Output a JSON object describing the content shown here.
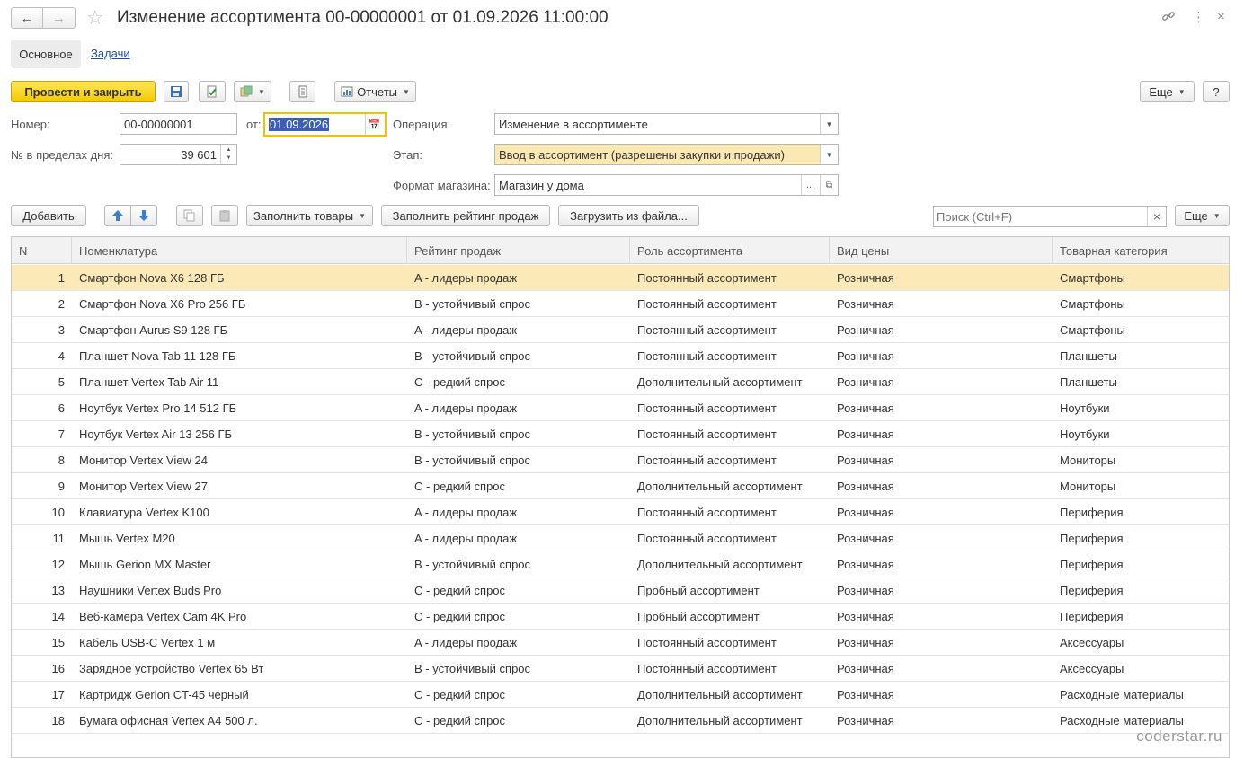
{
  "window": {
    "title": "Изменение ассортимента 00-00000001 от 01.09.2026 11:00:00"
  },
  "tabs": {
    "main": "Основное",
    "tasks": "Задачи"
  },
  "toolbar": {
    "post_close": "Провести и закрыть",
    "reports": "Отчеты",
    "more": "Еще",
    "help": "?"
  },
  "form": {
    "number_label": "Номер:",
    "number_value": "00-00000001",
    "date_label": "от:",
    "date_value": "01.09.2026",
    "daynum_label": "№ в пределах дня:",
    "daynum_value": "39 601",
    "operation_label": "Операция:",
    "operation_value": "Изменение в ассортименте",
    "stage_label": "Этап:",
    "stage_value": "Ввод в ассортимент (разрешены закупки и продажи)",
    "format_label": "Формат магазина:",
    "format_value": "Магазин у дома"
  },
  "table_toolbar": {
    "add": "Добавить",
    "fill_goods": "Заполнить товары",
    "fill_rating": "Заполнить рейтинг продаж",
    "load_file": "Загрузить из файла...",
    "search_placeholder": "Поиск (Ctrl+F)",
    "search_clear": "×",
    "more": "Еще"
  },
  "table": {
    "columns": [
      "N",
      "Номенклатура",
      "Рейтинг продаж",
      "Роль ассортимента",
      "Вид цены",
      "Товарная категория"
    ],
    "rows": [
      [
        "1",
        "Смартфон Nova X6 128 ГБ",
        "A - лидеры продаж",
        "Постоянный ассортимент",
        "Розничная",
        "Смартфоны"
      ],
      [
        "2",
        "Смартфон Nova X6 Pro 256 ГБ",
        "B - устойчивый спрос",
        "Постоянный ассортимент",
        "Розничная",
        "Смартфоны"
      ],
      [
        "3",
        "Смартфон Aurus S9 128 ГБ",
        "A - лидеры продаж",
        "Постоянный ассортимент",
        "Розничная",
        "Смартфоны"
      ],
      [
        "4",
        "Планшет Nova Tab 11 128 ГБ",
        "B - устойчивый спрос",
        "Постоянный ассортимент",
        "Розничная",
        "Планшеты"
      ],
      [
        "5",
        "Планшет Vertex Tab Air 11",
        "C - редкий спрос",
        "Дополнительный ассортимент",
        "Розничная",
        "Планшеты"
      ],
      [
        "6",
        "Ноутбук Vertex Pro 14 512 ГБ",
        "A - лидеры продаж",
        "Постоянный ассортимент",
        "Розничная",
        "Ноутбуки"
      ],
      [
        "7",
        "Ноутбук Vertex Air 13 256 ГБ",
        "B - устойчивый спрос",
        "Постоянный ассортимент",
        "Розничная",
        "Ноутбуки"
      ],
      [
        "8",
        "Монитор Vertex View 24",
        "B - устойчивый спрос",
        "Постоянный ассортимент",
        "Розничная",
        "Мониторы"
      ],
      [
        "9",
        "Монитор Vertex View 27",
        "C - редкий спрос",
        "Дополнительный ассортимент",
        "Розничная",
        "Мониторы"
      ],
      [
        "10",
        "Клавиатура Vertex K100",
        "A - лидеры продаж",
        "Постоянный ассортимент",
        "Розничная",
        "Периферия"
      ],
      [
        "11",
        "Мышь Vertex M20",
        "A - лидеры продаж",
        "Постоянный ассортимент",
        "Розничная",
        "Периферия"
      ],
      [
        "12",
        "Мышь Gerion MX Master",
        "B - устойчивый спрос",
        "Дополнительный ассортимент",
        "Розничная",
        "Периферия"
      ],
      [
        "13",
        "Наушники Vertex Buds Pro",
        "C - редкий спрос",
        "Пробный ассортимент",
        "Розничная",
        "Периферия"
      ],
      [
        "14",
        "Веб-камера Vertex Cam 4K Pro",
        "C - редкий спрос",
        "Пробный ассортимент",
        "Розничная",
        "Периферия"
      ],
      [
        "15",
        "Кабель USB-C Vertex 1 м",
        "A - лидеры продаж",
        "Постоянный ассортимент",
        "Розничная",
        "Аксессуары"
      ],
      [
        "16",
        "Зарядное устройство Vertex 65 Вт",
        "B - устойчивый спрос",
        "Постоянный ассортимент",
        "Розничная",
        "Аксессуары"
      ],
      [
        "17",
        "Картридж Gerion CT-45 черный",
        "C - редкий спрос",
        "Дополнительный ассортимент",
        "Розничная",
        "Расходные материалы"
      ],
      [
        "18",
        "Бумага офисная Vertex A4 500 л.",
        "C - редкий спрос",
        "Дополнительный ассортимент",
        "Розничная",
        "Расходные материалы"
      ]
    ]
  },
  "watermark": "coderstar.ru",
  "colors": {
    "primary": "#f2c900",
    "selected_row": "#fbeab7",
    "link": "#1f4e9e"
  }
}
